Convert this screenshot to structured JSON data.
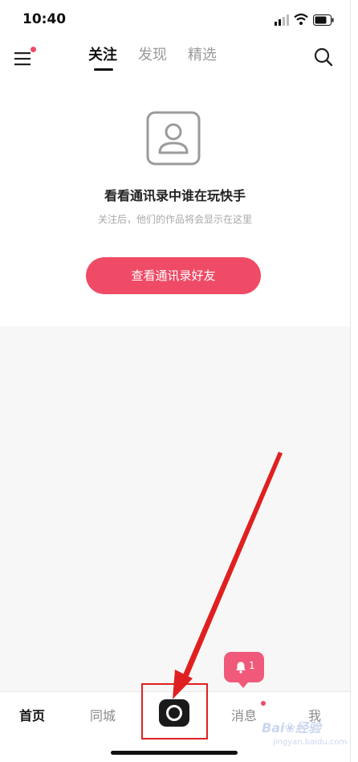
{
  "status_bar": {
    "time": "10:40"
  },
  "top_nav": {
    "tabs": [
      {
        "label": "关注",
        "active": true
      },
      {
        "label": "发现",
        "active": false
      },
      {
        "label": "精选",
        "active": false
      }
    ]
  },
  "empty_state": {
    "title": "看看通讯录中谁在玩快手",
    "subtitle": "关注后，他们的作品将会显示在这里",
    "button_label": "查看通讯录好友"
  },
  "notification": {
    "count": "1"
  },
  "bottom_nav": {
    "home": "首页",
    "local": "同城",
    "messages": "消息",
    "me": "我"
  },
  "watermark": {
    "main": "Bai❀经验",
    "sub": "jingyan.baidu.com"
  },
  "colors": {
    "accent": "#ef4b66",
    "annotation": "#e02020"
  }
}
